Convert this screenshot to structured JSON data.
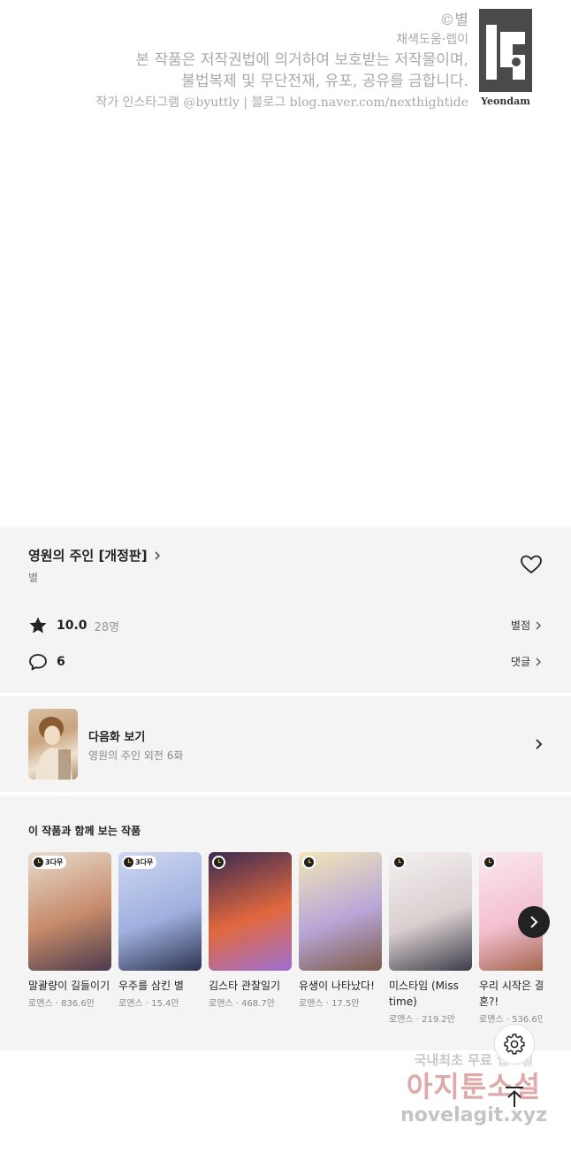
{
  "copyright": {
    "line1": "©별",
    "line2": "채색도움·렙이",
    "line3": "본 작품은 저작권법에 의거하여 보호받는 저작물이며,",
    "line4": "불법복제 및 무단전재, 유포, 공유를 금합니다.",
    "line5": "작가 인스타그램  @byuttly | 블로그  blog.naver.com/nexthightide",
    "publisher_logo_text": "Yeondam"
  },
  "work": {
    "title": "영원의 주인 [개정판]",
    "author": "별",
    "rating": "10.0",
    "rating_count": "28명",
    "rate_link": "별점",
    "comment_count": "6",
    "comment_link": "댓글",
    "favorited": false
  },
  "next_episode": {
    "label": "다음화 보기",
    "subtitle": "영원의 주인 외전 6화"
  },
  "recommendations": {
    "heading": "이 작품과 함께 보는 작품",
    "items": [
      {
        "title": "말괄량이 길들이기",
        "meta": "로맨스 · 836.6만",
        "badge": "3다무",
        "colors": [
          "#e9dccd",
          "#c58a6a",
          "#4b3a4c"
        ]
      },
      {
        "title": "우주를 삼킨 별",
        "meta": "로맨스 · 15.4만",
        "badge": "3다무",
        "colors": [
          "#cfd7f2",
          "#9fb0de",
          "#2c3350"
        ]
      },
      {
        "title": "김스타 관찰일기",
        "meta": "로맨스 · 468.7만",
        "badge": "",
        "colors": [
          "#3a2a52",
          "#e1683e",
          "#9b6fd3"
        ]
      },
      {
        "title": "유생이 나타났다!",
        "meta": "로맨스 · 17.5만",
        "badge": "",
        "colors": [
          "#f1e7b6",
          "#b9a6d8",
          "#7b5b4a"
        ]
      },
      {
        "title": "미스타임 (Miss time)",
        "meta": "로맨스 · 219.2만",
        "badge": "",
        "colors": [
          "#f4f0ef",
          "#d9cfcf",
          "#3c3c48"
        ]
      },
      {
        "title": "우리 시작은 결혼?!",
        "meta": "로맨스 · 536.6만",
        "badge": "",
        "colors": [
          "#fbe9ee",
          "#f3bfcf",
          "#9b5a3f"
        ]
      }
    ]
  },
  "watermark": {
    "line1_a": "국내최초 무료",
    "line1_b": "웹소설",
    "line2": "아지툰소설",
    "line3": "novelagit.xyz"
  }
}
